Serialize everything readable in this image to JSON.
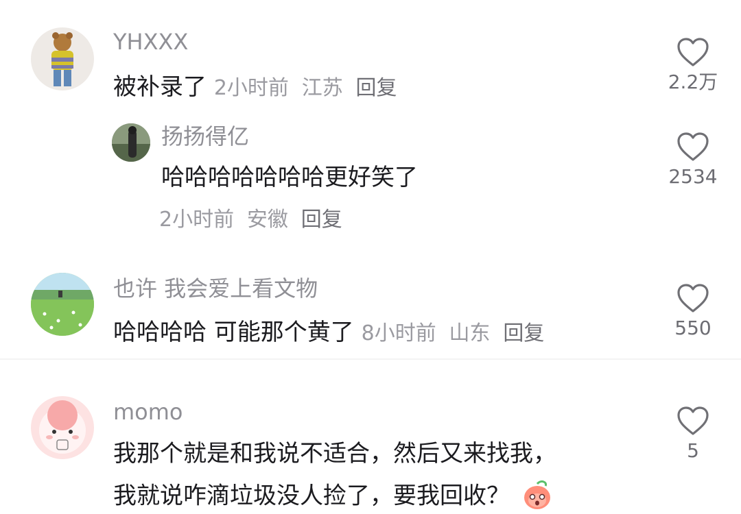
{
  "comments": [
    {
      "user": "YHXXX",
      "text": "被补录了",
      "time": "2小时前",
      "location": "江苏",
      "reply_label": "回复",
      "likes": "2.2万"
    },
    {
      "user": "扬扬得亿",
      "text": "哈哈哈哈哈哈哈更好笑了",
      "time": "2小时前",
      "location": "安徽",
      "reply_label": "回复",
      "likes": "2534"
    },
    {
      "user": "也许 我会爱上看文物",
      "text": "哈哈哈哈 可能那个黄了",
      "time": "8小时前",
      "location": "山东",
      "reply_label": "回复",
      "likes": "550"
    },
    {
      "user": "momo",
      "text_line1": "我那个就是和我说不适合，然后又来找我，",
      "text_line2": "我就说咋滴垃圾没人捡了，要我回收？",
      "likes": "5"
    }
  ],
  "colors": {
    "username": "#8f8f95",
    "comment_text": "#1b1b1f",
    "meta": "#9a9aa0",
    "heart_outline": "#707075"
  }
}
